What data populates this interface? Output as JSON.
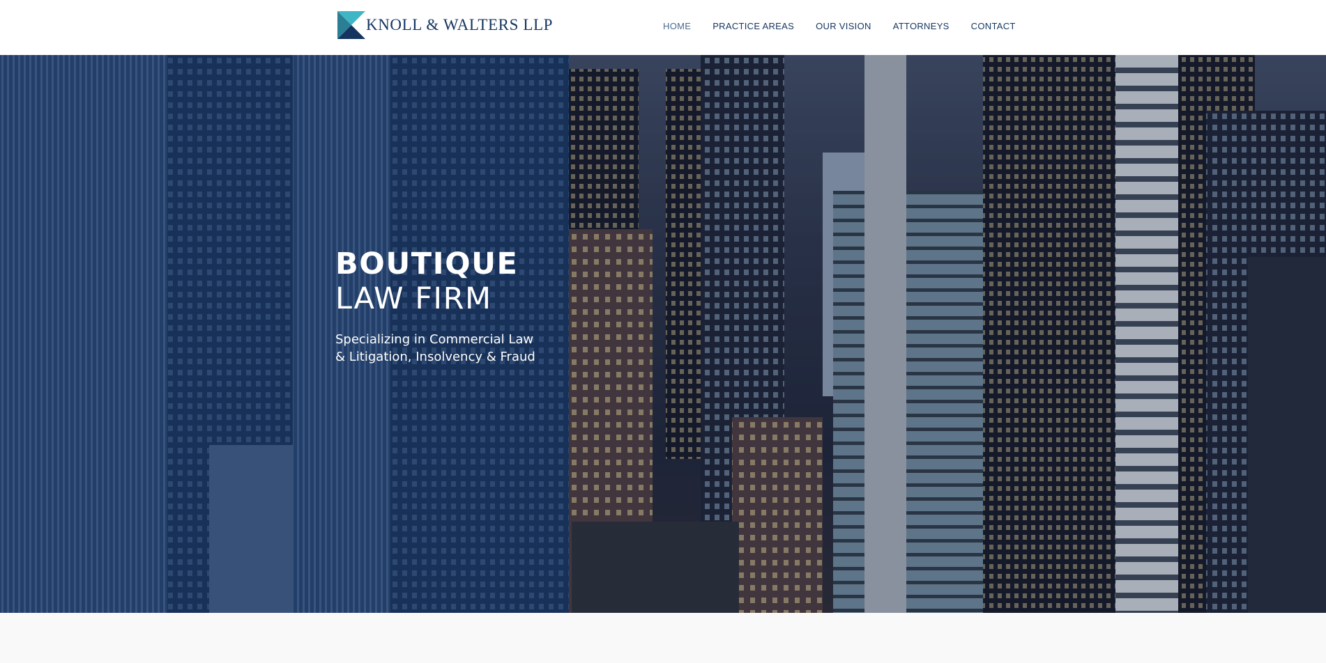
{
  "brand": {
    "name": "KNOLL & WALTERS LLP",
    "logo_icon": "triangle-k-logo-icon",
    "colors": {
      "navy": "#14345f",
      "teal": "#3fb6c4",
      "overlay": "#163a6e"
    }
  },
  "nav": {
    "items": [
      {
        "label": "HOME",
        "active": true
      },
      {
        "label": "PRACTICE AREAS",
        "active": false
      },
      {
        "label": "OUR VISION",
        "active": false
      },
      {
        "label": "ATTORNEYS",
        "active": false
      },
      {
        "label": "CONTACT",
        "active": false
      }
    ]
  },
  "hero": {
    "title_line1": "BOUTIQUE",
    "title_line2": "LAW FIRM",
    "subtitle": "Specializing in Commercial Law & Litigation, Insolvency & Fraud",
    "background": "city-skyline-image"
  }
}
